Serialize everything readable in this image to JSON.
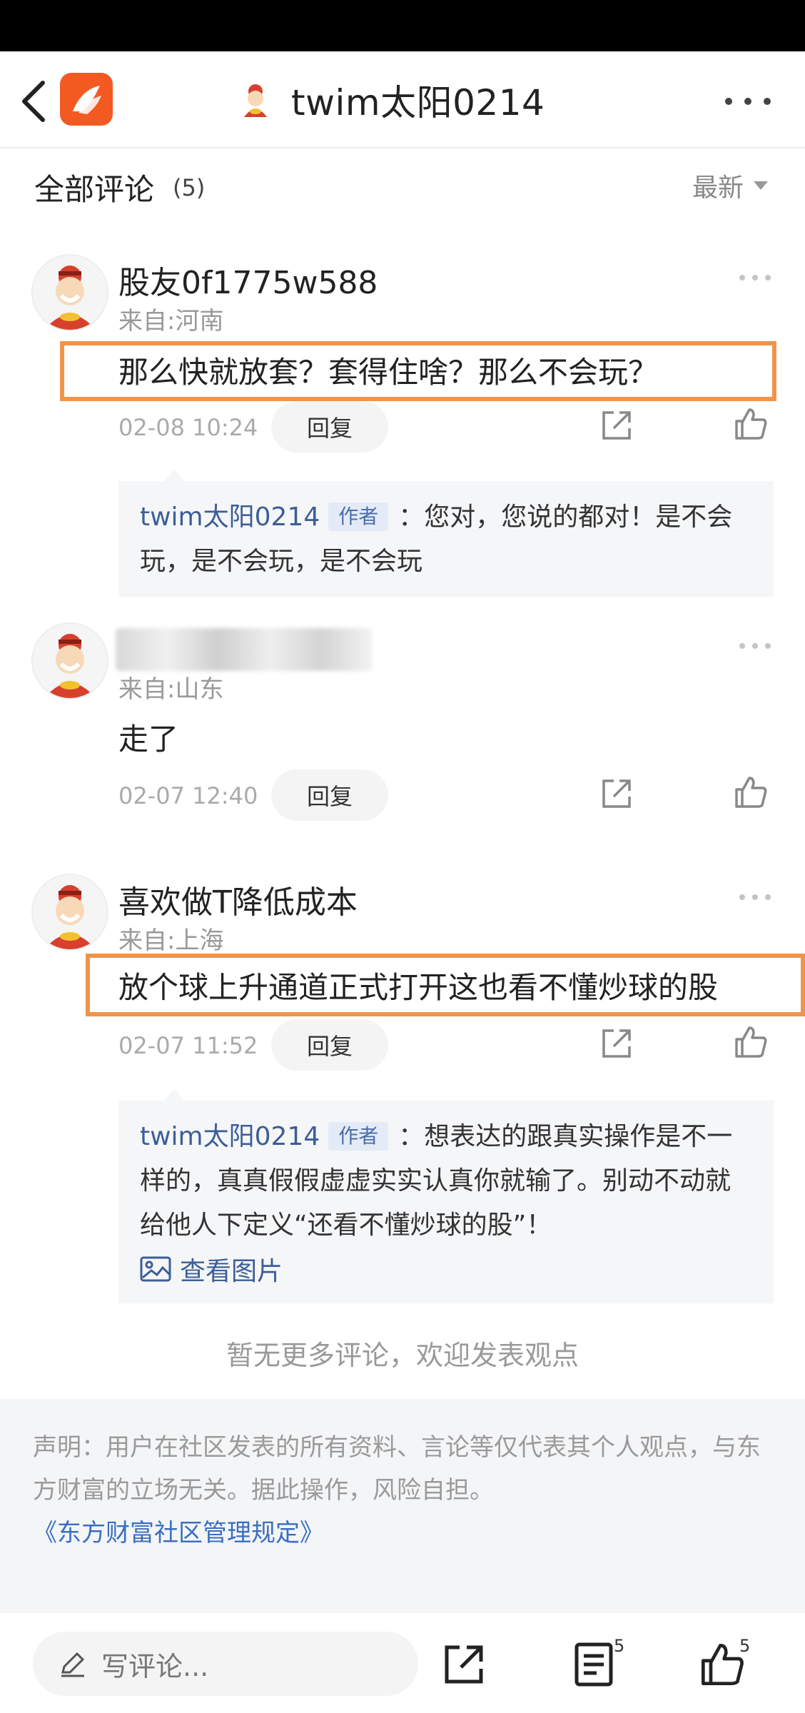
{
  "nav": {
    "title": "twim太阳0214"
  },
  "header": {
    "title": "全部评论",
    "count": "(5)",
    "sort_label": "最新"
  },
  "comments": [
    {
      "username": "股友0f1775w588",
      "location": "来自:河南",
      "text": "那么快就放套？套得住啥？那么不会玩？",
      "time": "02-08 10:24",
      "reply_label": "回复",
      "reply": {
        "author": "twim太阳0214",
        "tag": "作者",
        "text": "：您对，您说的都对！是不会玩，是不会玩，是不会玩"
      }
    },
    {
      "username": "",
      "location": "来自:山东",
      "text": "走了",
      "time": "02-07 12:40",
      "reply_label": "回复"
    },
    {
      "username": "喜欢做T降低成本",
      "location": "来自:上海",
      "text": "放个球上升通道正式打开这也看不懂炒球的股",
      "time": "02-07 11:52",
      "reply_label": "回复",
      "reply": {
        "author": "twim太阳0214",
        "tag": "作者",
        "text": "：想表达的跟真实操作是不一样的，真真假假虚虚实实认真你就输了。别动不动就给他人下定义“还看不懂炒球的股”！",
        "view_image": "查看图片"
      }
    }
  ],
  "footer": {
    "no_more": "暂无更多评论，欢迎发表观点",
    "disclaimer": "声明：用户在社区发表的所有资料、言论等仅代表其个人观点，与东方财富的立场无关。据此操作，风险自担。",
    "rules_link": "《东方财富社区管理规定》"
  },
  "bottom": {
    "write_placeholder": "写评论...",
    "comment_count": "5",
    "like_count": "5"
  },
  "colors": {
    "brand": "#f25a22",
    "highlight_border": "#f0944a",
    "author_blue": "#3c5e98"
  }
}
